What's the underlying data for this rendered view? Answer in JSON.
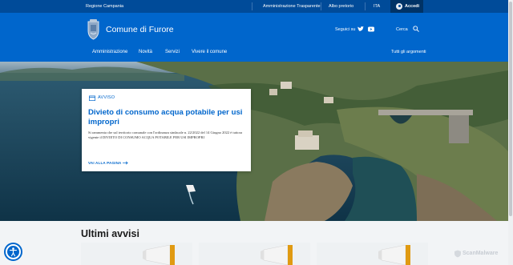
{
  "topbar": {
    "region": "Regione Campania",
    "links": [
      "Amministrazione Trasparente",
      "Albo pretorio"
    ],
    "language": "ITA",
    "login_label": "Accedi"
  },
  "header": {
    "title": "Comune di Furore",
    "social_label": "Seguici su",
    "social_icons": [
      "twitter-icon",
      "youtube-icon"
    ],
    "search_label": "Cerca"
  },
  "nav": {
    "items": [
      "Amministrazione",
      "Novità",
      "Servizi",
      "Vivere il comune"
    ],
    "all_topics": "Tutti gli argomenti"
  },
  "hero_card": {
    "kind": "AVVISO",
    "title": "Divieto di consumo acqua potabile per usi impropri",
    "body": "Si rammenta che sul territorio comunale con l'ordinanza sindacale n. 22/2022 del 14 Giugno 2022 è tuttora vigente il DIVIETO DI CONSUMO ACQUA POTABILE PER USI IMPROPRI",
    "link_label": "VAI ALLA PAGINA"
  },
  "section": {
    "title": "Ultimi avvisi"
  },
  "watermark": "ScanMalware",
  "colors": {
    "primary": "#0066cc",
    "topbar": "#004b99",
    "login": "#003366"
  }
}
